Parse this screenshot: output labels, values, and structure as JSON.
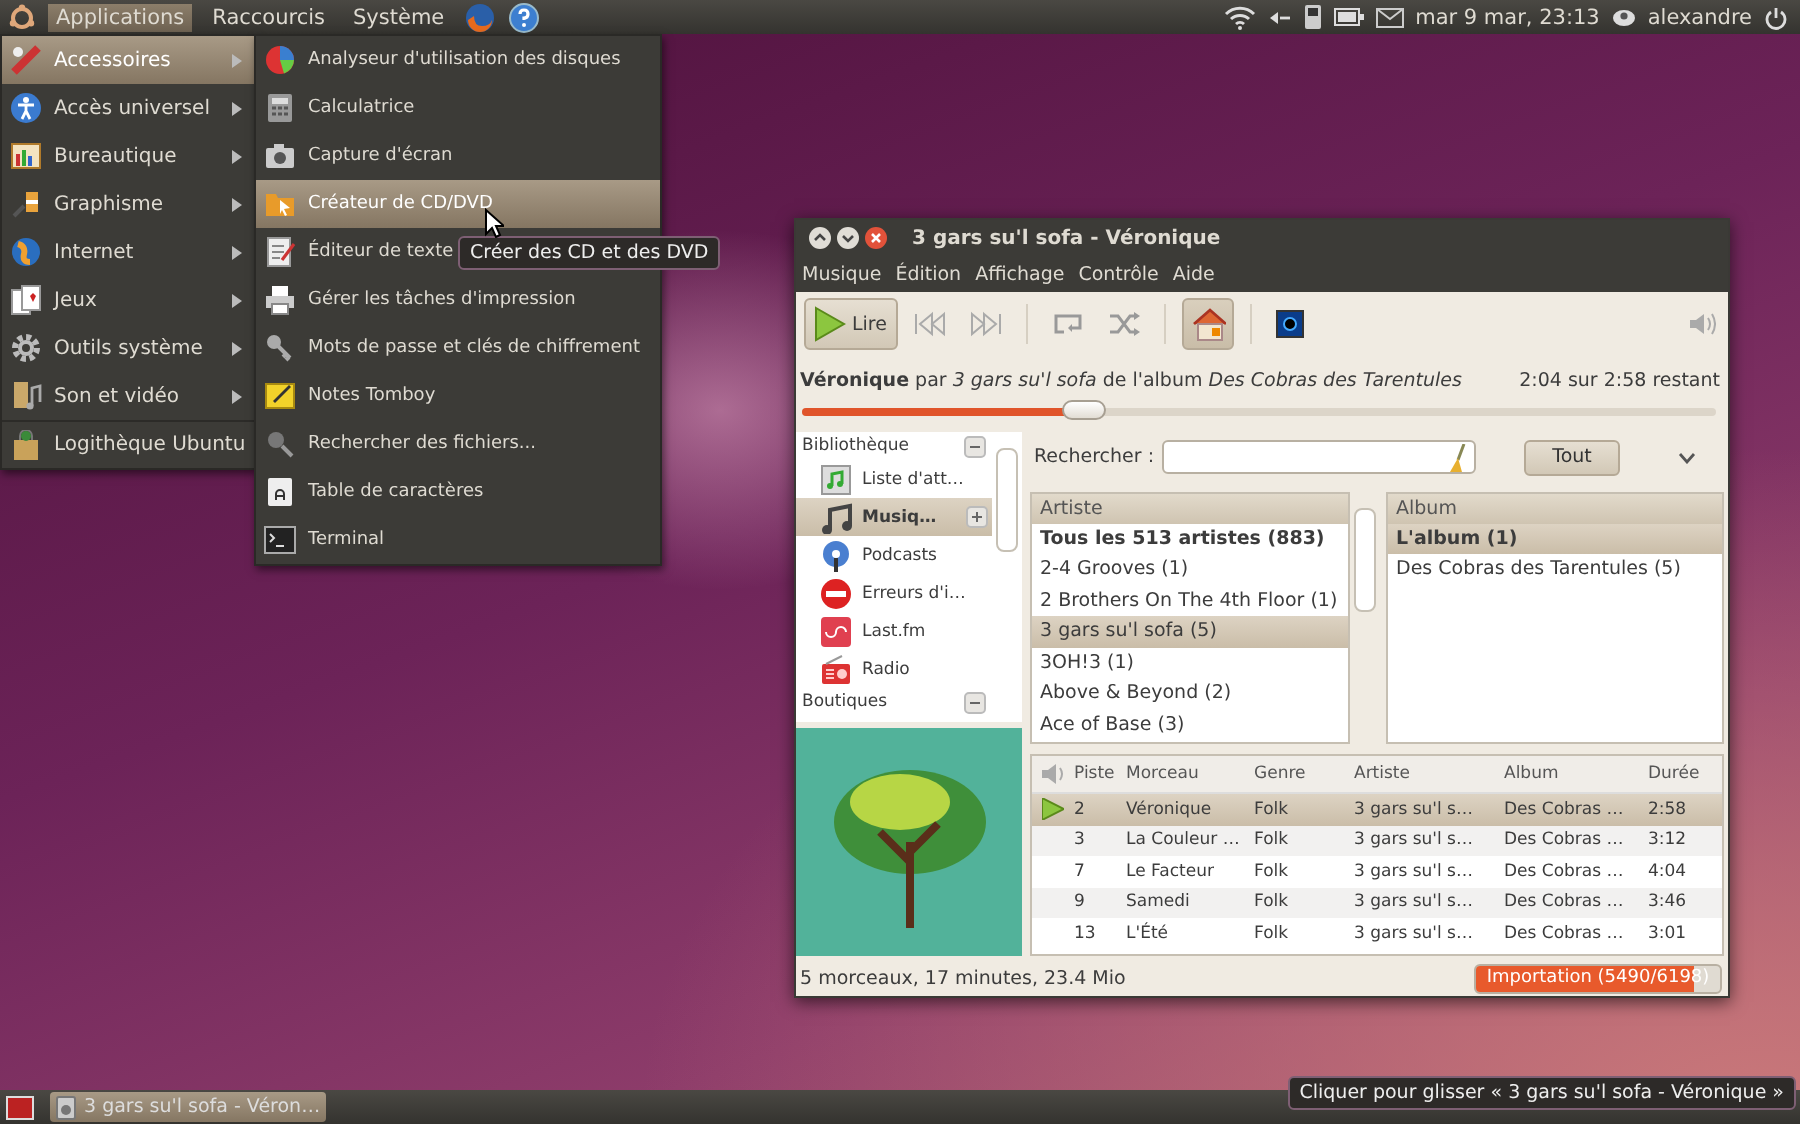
{
  "top_panel": {
    "menus": [
      {
        "label": "Applications",
        "selected": true
      },
      {
        "label": "Raccourcis",
        "selected": false
      },
      {
        "label": "Système",
        "selected": false
      }
    ],
    "clock": "mar 9 mar, 23:13",
    "user": "alexandre"
  },
  "applications_menu": {
    "items": [
      {
        "label": "Accessoires",
        "selected": true,
        "submenu": true
      },
      {
        "label": "Accès universel",
        "selected": false,
        "submenu": true
      },
      {
        "label": "Bureautique",
        "selected": false,
        "submenu": true
      },
      {
        "label": "Graphisme",
        "selected": false,
        "submenu": true
      },
      {
        "label": "Internet",
        "selected": false,
        "submenu": true
      },
      {
        "label": "Jeux",
        "selected": false,
        "submenu": true
      },
      {
        "label": "Outils système",
        "selected": false,
        "submenu": true
      },
      {
        "label": "Son et vidéo",
        "selected": false,
        "submenu": true
      },
      {
        "label": "Logithèque Ubuntu",
        "selected": false,
        "submenu": false
      }
    ]
  },
  "accessories_menu": {
    "items": [
      {
        "label": "Analyseur d'utilisation des disques",
        "selected": false
      },
      {
        "label": "Calculatrice",
        "selected": false
      },
      {
        "label": "Capture d'écran",
        "selected": false
      },
      {
        "label": "Créateur de CD/DVD",
        "selected": true
      },
      {
        "label": "Éditeur de texte",
        "selected": false
      },
      {
        "label": "Gérer les tâches d'impression",
        "selected": false
      },
      {
        "label": "Mots de passe et clés de chiffrement",
        "selected": false
      },
      {
        "label": "Notes Tomboy",
        "selected": false
      },
      {
        "label": "Rechercher des fichiers...",
        "selected": false
      },
      {
        "label": "Table de caractères",
        "selected": false
      },
      {
        "label": "Terminal",
        "selected": false
      }
    ]
  },
  "tooltip": "Créer des CD et des DVD",
  "player": {
    "title": "3 gars su'l sofa - Véronique",
    "menu": [
      "Musique",
      "Édition",
      "Affichage",
      "Contrôle",
      "Aide"
    ],
    "toolbar": [
      {
        "kind": "play",
        "label": "Lire"
      },
      {
        "kind": "previous"
      },
      {
        "kind": "next"
      },
      {
        "kind": "repeat",
        "on": false
      },
      {
        "kind": "shuffle",
        "on": false
      },
      {
        "kind": "browse",
        "on": true
      },
      {
        "kind": "visualizer",
        "on": false
      }
    ],
    "now_playing": "**Véronique** par *3 gars su'l sofa* de l'album *Des Cobras des Tarentules*",
    "time": "2:04 sur 2:58 restant",
    "position": {
      "level": 0.31
    },
    "sidebar": {
      "groups": [
        {
          "label": "Bibliothèque",
          "expanded": true,
          "items": [
            {
              "label": "Liste d'att…",
              "selected": false,
              "addable": false
            },
            {
              "label": "Musiq…",
              "selected": true,
              "addable": true
            },
            {
              "label": "Podcasts",
              "selected": false,
              "addable": false
            },
            {
              "label": "Erreurs d'i…",
              "selected": false,
              "addable": false
            },
            {
              "label": "Last.fm",
              "selected": false,
              "addable": false
            },
            {
              "label": "Radio",
              "selected": false,
              "addable": false
            }
          ]
        },
        {
          "label": "Boutiques",
          "expanded": true
        }
      ]
    },
    "search": {
      "label": "Rechercher :",
      "button": "Tout"
    },
    "artists": {
      "header": "Artiste",
      "items": [
        {
          "label": "Tous les 513 artistes (883)",
          "kind": "all",
          "selected": false
        },
        {
          "label": "2-4 Grooves (1)",
          "kind": "artist",
          "selected": false
        },
        {
          "label": "2 Brothers On The 4th Floor (1)",
          "kind": "artist",
          "selected": false
        },
        {
          "label": "3 gars su'l sofa (5)",
          "kind": "artist",
          "selected": true
        },
        {
          "label": "3OH!3 (1)",
          "kind": "artist",
          "selected": false
        },
        {
          "label": "Above & Beyond (2)",
          "kind": "artist",
          "selected": false
        },
        {
          "label": "Ace of Base (3)",
          "kind": "artist",
          "selected": false
        }
      ]
    },
    "albums": {
      "header": "Album",
      "items": [
        {
          "label": "L'album (1)",
          "kind": "all",
          "selected": true
        },
        {
          "label": "Des Cobras des Tarentules (5)",
          "kind": "album",
          "selected": false
        }
      ]
    },
    "tracks": {
      "columns": [
        "Piste",
        "Morceau",
        "Genre",
        "Artiste",
        "Album",
        "Durée"
      ],
      "rows": [
        {
          "cells": [
            "2",
            "Véronique",
            "Folk",
            "3 gars su'l s…",
            "Des Cobras …",
            "2:58"
          ],
          "playing": true,
          "selected": true
        },
        {
          "cells": [
            "3",
            "La Couleur …",
            "Folk",
            "3 gars su'l s…",
            "Des Cobras …",
            "3:12"
          ],
          "playing": false,
          "selected": false
        },
        {
          "cells": [
            "7",
            "Le Facteur",
            "Folk",
            "3 gars su'l s…",
            "Des Cobras …",
            "4:04"
          ],
          "playing": false,
          "selected": false
        },
        {
          "cells": [
            "9",
            "Samedi",
            "Folk",
            "3 gars su'l s…",
            "Des Cobras …",
            "3:46"
          ],
          "playing": false,
          "selected": false
        },
        {
          "cells": [
            "13",
            "L'Été",
            "Folk",
            "3 gars su'l s…",
            "Des Cobras …",
            "3:01"
          ],
          "playing": false,
          "selected": false
        }
      ]
    },
    "status": "5 morceaux, 17 minutes, 23.4 Mio",
    "import": {
      "label": "Importation (5490/6198)",
      "level": 0.89
    }
  },
  "bottom_panel": {
    "tasks": [
      {
        "label": "3 gars su'l sofa - Véron…",
        "selected": true
      }
    ]
  },
  "notification": "Cliquer pour glisser « 3 gars su'l sofa - Véronique »"
}
